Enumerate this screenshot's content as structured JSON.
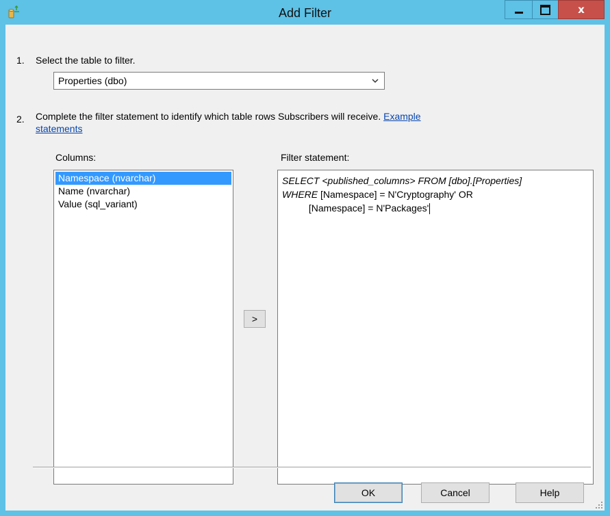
{
  "window": {
    "title": "Add Filter",
    "icon": "filter-db-icon"
  },
  "controls": {
    "minimize": "minimize-icon",
    "maximize": "maximize-icon",
    "close": "close-icon",
    "close_glyph": "x"
  },
  "step1": {
    "number": "1.",
    "text": "Select the table to filter.",
    "table_value": "Properties (dbo)"
  },
  "step2": {
    "number": "2.",
    "text": "Complete the filter statement to identify which table rows Subscribers will receive.",
    "link_part1": "Example",
    "link_part2": "statements"
  },
  "columns": {
    "label": "Columns:",
    "items": [
      {
        "label": "Namespace (nvarchar)",
        "selected": true
      },
      {
        "label": "Name (nvarchar)",
        "selected": false
      },
      {
        "label": "Value (sql_variant)",
        "selected": false
      }
    ]
  },
  "add_button": ">",
  "filter": {
    "label": "Filter statement:",
    "line1": "SELECT <published_columns> FROM [dbo].[Properties]",
    "line2_keyword": "WHERE",
    "line2_rest": " [Namespace] = N'Cryptography' OR",
    "line3": "          [Namespace] = N'Packages'"
  },
  "buttons": {
    "ok": "OK",
    "cancel": "Cancel",
    "help": "Help"
  },
  "colors": {
    "titlebar": "#5ec1e6",
    "close": "#c7504b",
    "selection": "#3399ff",
    "link": "#0645ad"
  }
}
